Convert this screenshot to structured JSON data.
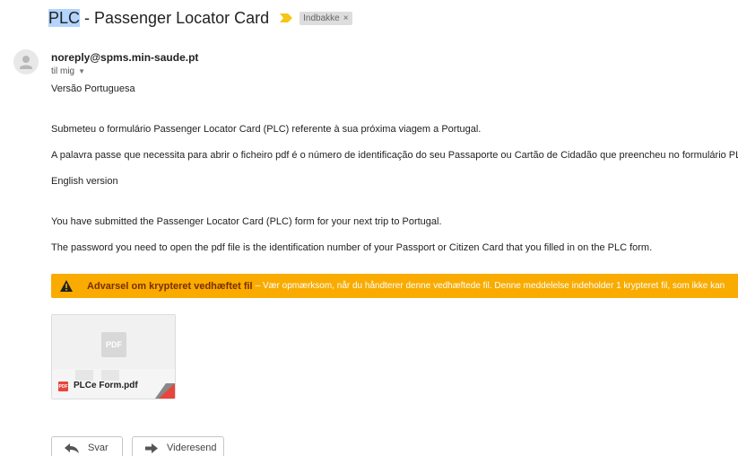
{
  "email": {
    "subject_highlight": "PLC",
    "subject_rest": " - Passenger Locator Card",
    "label": "Indbakke",
    "label_close": "×",
    "sender": "noreply@spms.min-saude.pt",
    "recipient": "til mig",
    "body": [
      "Versão Portuguesa",
      "Submeteu o formulário Passenger Locator Card (PLC) referente à sua próxima viagem a Portugal.",
      "A palavra passe que necessita para abrir o ficheiro pdf é o número de identificação do seu Passaporte ou Cartão de Cidadão que preencheu no formulário PLC.",
      "English version",
      "You have submitted the Passenger Locator Card (PLC) form for your next trip to Portugal.",
      "The password you need to open the pdf file is the identification number of your Passport or Citizen Card that you filled in on the PLC form."
    ]
  },
  "warning": {
    "title": "Advarsel om krypteret vedhæftet fil",
    "text": "– Vær opmærksom, når du håndterer denne vedhæftede fil. Denne meddelelse indeholder 1 krypteret fil, som ikke kan",
    "color": "#f9ab00"
  },
  "attachment": {
    "preview_label": "PDF",
    "type_badge": "PDF",
    "filename": "PLCe Form.pdf"
  },
  "actions": {
    "reply": "Svar",
    "forward": "Videresend"
  },
  "icons": {
    "importance": "importance-marker-icon",
    "avatar": "default-avatar-icon",
    "warning": "warning-triangle-icon",
    "reply": "reply-arrow-icon",
    "forward": "forward-arrow-icon"
  }
}
